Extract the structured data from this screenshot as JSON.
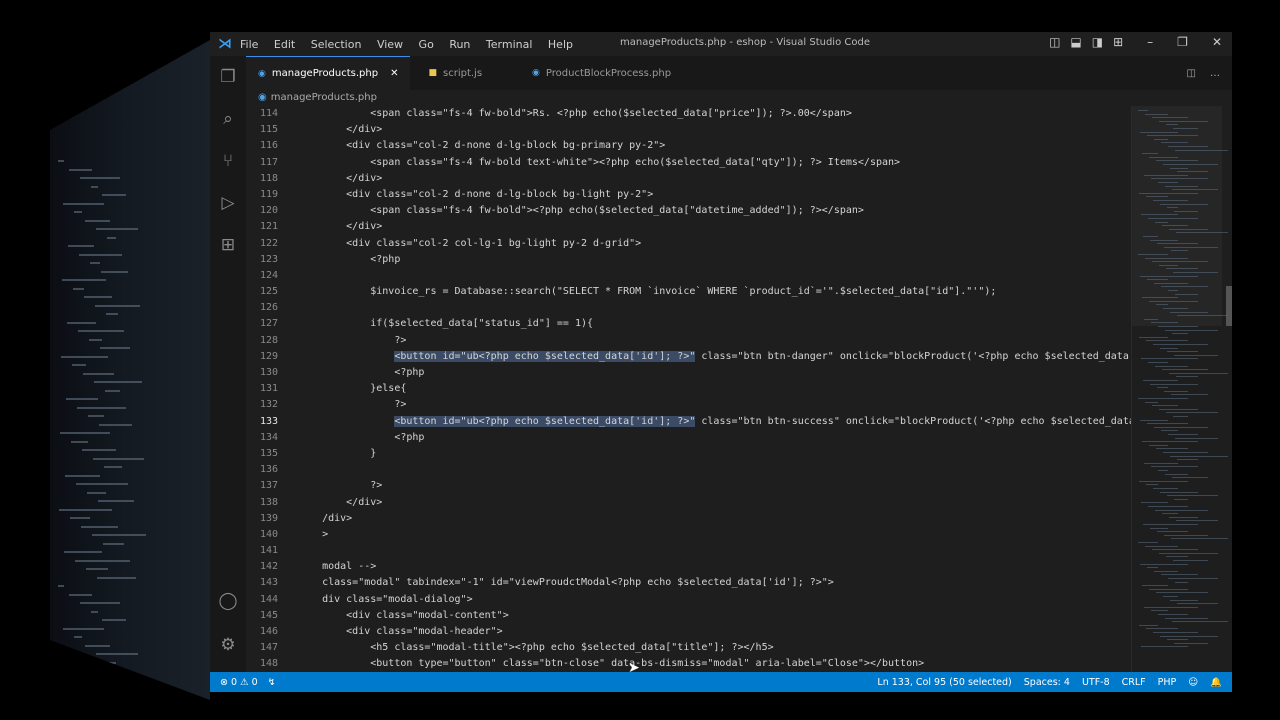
{
  "window": {
    "title": "manageProducts.php - eshop - Visual Studio Code",
    "menu": [
      "File",
      "Edit",
      "Selection",
      "View",
      "Go",
      "Run",
      "Terminal",
      "Help"
    ]
  },
  "tabs": [
    {
      "label": "manageProducts.php",
      "active": true,
      "icon": "php-icon"
    },
    {
      "label": "script.js",
      "active": false,
      "icon": "js-icon"
    },
    {
      "label": "ProductBlockProcess.php",
      "active": false,
      "icon": "php-icon"
    }
  ],
  "breadcrumb": "manageProducts.php",
  "editor": {
    "current_line": "133",
    "lines": [
      {
        "n": "114",
        "t": "            <span class=\"fs-4 fw-bold\">Rs. <?php echo($selected_data[\"price\"]); ?>.00</span>"
      },
      {
        "n": "115",
        "t": "        </div>"
      },
      {
        "n": "116",
        "t": "        <div class=\"col-2 d-none d-lg-block bg-primary py-2\">"
      },
      {
        "n": "117",
        "t": "            <span class=\"fs-4 fw-bold text-white\"><?php echo($selected_data[\"qty\"]); ?> Items</span>"
      },
      {
        "n": "118",
        "t": "        </div>"
      },
      {
        "n": "119",
        "t": "        <div class=\"col-2 d-none d-lg-block bg-light py-2\">"
      },
      {
        "n": "120",
        "t": "            <span class=\"fs-4 fw-bold\"><?php echo($selected_data[\"datetime_added\"]); ?></span>"
      },
      {
        "n": "121",
        "t": "        </div>"
      },
      {
        "n": "122",
        "t": "        <div class=\"col-2 col-lg-1 bg-light py-2 d-grid\">"
      },
      {
        "n": "123",
        "t": "            <?php"
      },
      {
        "n": "124",
        "t": ""
      },
      {
        "n": "125",
        "t": "            $invoice_rs = Database::search(\"SELECT * FROM `invoice` WHERE `product_id`='\".$selected_data[\"id\"].\"'\");"
      },
      {
        "n": "126",
        "t": ""
      },
      {
        "n": "127",
        "t": "            if($selected_data[\"status_id\"] == 1){"
      },
      {
        "n": "128",
        "t": "                ?>"
      },
      {
        "n": "129",
        "t": "                <button id=\"ub<?php echo $selected_data['id']; ?>\" class=\"btn btn-danger\" onclick=\"blockProduct('<?php echo $selected_data['id']; ?>')"
      },
      {
        "n": "130",
        "t": "                <?php"
      },
      {
        "n": "131",
        "t": "            }else{"
      },
      {
        "n": "132",
        "t": "                ?>"
      },
      {
        "n": "133",
        "t": "                <button id=\"ub<?php echo $selected_data['id']; ?>\" class=\"btn btn-success\" onclick=\"blockProduct('<?php echo $selected_data['id']; ?>'"
      },
      {
        "n": "134",
        "t": "                <?php"
      },
      {
        "n": "135",
        "t": "            }"
      },
      {
        "n": "136",
        "t": ""
      },
      {
        "n": "137",
        "t": "            ?>"
      },
      {
        "n": "138",
        "t": "        </div>"
      },
      {
        "n": "139",
        "t": "    /div>"
      },
      {
        "n": "140",
        "t": "    >"
      },
      {
        "n": "141",
        "t": ""
      },
      {
        "n": "142",
        "t": "    modal -->"
      },
      {
        "n": "143",
        "t": "    class=\"modal\" tabindex=\"-1\" id=\"viewProudctModal<?php echo $selected_data['id']; ?>\">"
      },
      {
        "n": "144",
        "t": "    div class=\"modal-dialog\">"
      },
      {
        "n": "145",
        "t": "        <div class=\"modal-content\">"
      },
      {
        "n": "146",
        "t": "        <div class=\"modal-header\">"
      },
      {
        "n": "147",
        "t": "            <h5 class=\"modal-title\"><?php echo $selected_data[\"title\"]; ?></h5>"
      },
      {
        "n": "148",
        "t": "            <button type=\"button\" class=\"btn-close\" data-bs-dismiss=\"modal\" aria-label=\"Close\"></button>"
      }
    ]
  },
  "status": {
    "errors": "0",
    "warnings": "0",
    "position": "Ln 133, Col 95 (50 selected)",
    "spaces": "Spaces: 4",
    "encoding": "UTF-8",
    "eol": "CRLF",
    "language": "PHP"
  },
  "colors": {
    "status_bar": "#007acc",
    "editor_bg": "#1e1e1e",
    "selection": "#3b4b66"
  }
}
